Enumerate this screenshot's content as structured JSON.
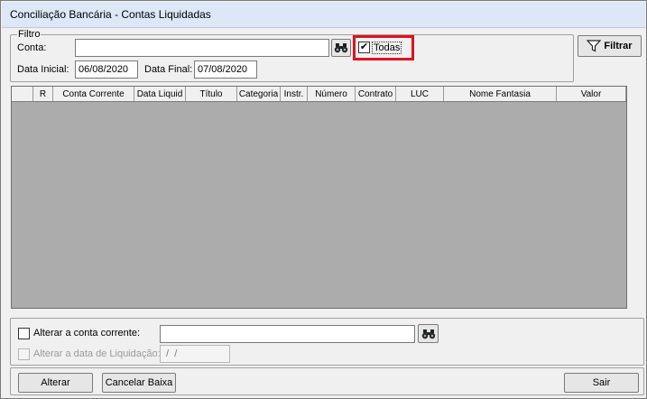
{
  "window": {
    "title": "Conciliação Bancária - Contas Liquidadas"
  },
  "filter": {
    "legend": "Filtro",
    "account_label": "Conta:",
    "account_value": "",
    "all_label": "Todas",
    "all_checked": true,
    "start_date_label": "Data Inicial:",
    "start_date_value": "06/08/2020",
    "end_date_label": "Data Final:",
    "end_date_value": "07/08/2020",
    "filter_button": "Filtrar"
  },
  "grid": {
    "columns": [
      "",
      "R",
      "Conta Corrente",
      "Data Liquid",
      "Título",
      "Categoria",
      "Instr.",
      "Número",
      "Contrato",
      "LUC",
      "Nome Fantasia",
      "Valor"
    ],
    "rows": []
  },
  "options": {
    "change_account_label": "Alterar a conta corrente:",
    "change_account_checked": false,
    "change_account_value": "",
    "change_date_label": "Alterar a data de Liquidação:",
    "change_date_checked": false,
    "change_date_value": " /  /"
  },
  "footer": {
    "alter_button": "Alterar",
    "cancel_button": "Cancelar Baixa",
    "exit_button": "Sair"
  },
  "icons": {
    "binoculars": "binoculars-icon",
    "funnel": "funnel-icon",
    "check": "✔"
  }
}
